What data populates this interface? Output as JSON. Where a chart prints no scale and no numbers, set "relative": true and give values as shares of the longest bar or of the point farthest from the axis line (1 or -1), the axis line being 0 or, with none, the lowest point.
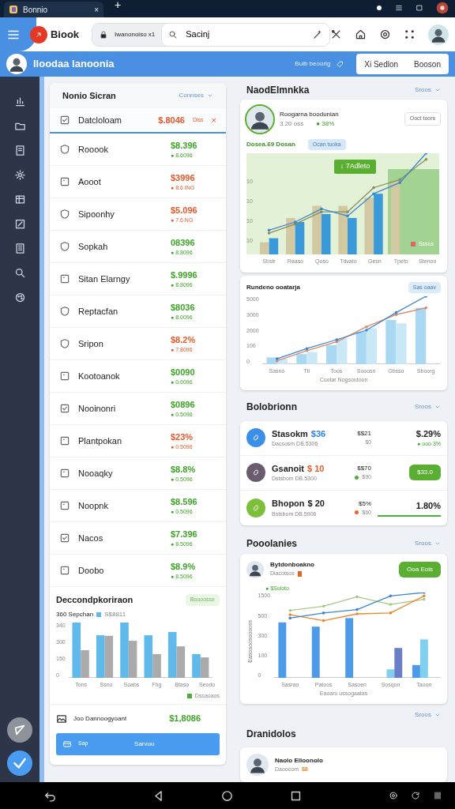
{
  "browser": {
    "tabs": [
      {
        "title": "Bonnio",
        "selected": true,
        "close": "×"
      }
    ],
    "new_tab": "+"
  },
  "address_bar": {
    "logo": "Biook",
    "url": "Iwanonoiso x1",
    "search": {
      "value": "Sacinj"
    }
  },
  "header": {
    "title": "Iloodaa lanoonia",
    "link": "Buib beoorig",
    "buttons": [
      "Xi Sedlon",
      "Booson"
    ]
  },
  "list_panel": {
    "title": "Nonio Sicran",
    "filter": "Connses",
    "rows": [
      {
        "name": "Datcloloam",
        "amount": "$.8046",
        "negative": true,
        "selected": true,
        "tag": "Diss",
        "close": "×"
      },
      {
        "name": "Rooook",
        "amount": "$8.396",
        "negative": false,
        "selected": false,
        "change": "● 8.6096"
      },
      {
        "name": "Aooot",
        "amount": "$3996",
        "negative": true,
        "selected": false,
        "change": "● 8.6 ING"
      },
      {
        "name": "Sipoonhy",
        "amount": "$5.096",
        "negative": true,
        "selected": false,
        "change": "● 7.6 NG"
      },
      {
        "name": "Sopkah",
        "amount": "08396",
        "negative": false,
        "selected": false,
        "change": "● 8.8096"
      },
      {
        "name": "Sitan Elarngy",
        "amount": "$.9996",
        "negative": false,
        "selected": false,
        "change": "● 8.8096"
      },
      {
        "name": "Reptacfan",
        "amount": "$8036",
        "negative": false,
        "selected": false,
        "change": "● 8.0096"
      },
      {
        "name": "Sripon",
        "amount": "$8.2%",
        "negative": true,
        "selected": false,
        "change": "● 7.8096"
      },
      {
        "name": "Kootoanok",
        "amount": "$0090",
        "negative": false,
        "selected": false,
        "change": "● 0.6096"
      },
      {
        "name": "Nooinonri",
        "amount": "$0896",
        "negative": false,
        "selected": false,
        "change": "● 0.5096"
      },
      {
        "name": "Plantpokan",
        "amount": "$23%",
        "negative": true,
        "selected": false,
        "change": "● 0.5096"
      },
      {
        "name": "Nooaqky",
        "amount": "$8.8%",
        "negative": false,
        "selected": false,
        "change": "● 0.5096"
      },
      {
        "name": "Noopnk",
        "amount": "$8.596",
        "negative": false,
        "selected": false,
        "change": "● 0.5096"
      },
      {
        "name": "Nacos",
        "amount": "$7.396",
        "negative": false,
        "selected": false,
        "change": "● 8.5096"
      },
      {
        "name": "Doobo",
        "amount": "$8.9%",
        "negative": false,
        "selected": false,
        "change": "● 8.5096"
      }
    ]
  },
  "summary_chart": {
    "title": "Deccondpkoriraon",
    "badge": "Boooosse",
    "caption": "360 Sepchan",
    "footer_legend": "Dscaoaos",
    "y_labels": [
      "340",
      "300",
      "150",
      "0"
    ],
    "chart_data": {
      "type": "bar",
      "relative": true,
      "categories": [
        "Tons",
        "Ssno",
        "Soabs",
        "Fhg",
        "Btaso",
        "Seodo"
      ],
      "series": [
        {
          "name": "S$8811",
          "color": "#5fb9ea",
          "values": [
            1,
            0.77,
            1,
            0.77,
            0.83,
            0.43
          ]
        },
        {
          "color": "#aaaaaa",
          "values": [
            0.5,
            0.76,
            0.67,
            0.43,
            0.57,
            0.37
          ]
        }
      ]
    }
  },
  "total": {
    "label": "Joo Dannoogyoant",
    "value": "$1,8086"
  },
  "action": {
    "note": "Sap",
    "label": "Sarvuu"
  },
  "metrics": {
    "title": "NaodElmnkka",
    "filter": "Sroos",
    "profile": {
      "name": "Roogarna boodunian",
      "sub": "3.20 oss",
      "stat": "● 38%",
      "button": "Ooct toors"
    },
    "chart": {
      "title": "Dosea.69 Dosan",
      "badge": "Ocan tuoka",
      "tooltip": "↓ 7Adleto",
      "legend": "Sssos",
      "y_labels": [
        "10",
        "10",
        "10",
        "10"
      ],
      "chart_data": {
        "type": "bar",
        "relative": true,
        "categories": [
          "Sbstr",
          "Reaso",
          "Qoso",
          "Tdvato",
          "Gesn",
          "Tpeto",
          "Stenon"
        ],
        "series": [
          {
            "color": "#d2c8a2",
            "values": [
              0.12,
              0.36,
              0.48,
              0.48,
              0.56,
              0.72,
              null
            ]
          },
          {
            "color": "#3a9ad9",
            "values": [
              0.16,
              0.32,
              0.4,
              0.36,
              0.6,
              null,
              null
            ]
          },
          {
            "type": "line",
            "color": "#8a8d5b",
            "values": [
              0.21,
              0.3,
              0.42,
              0.42,
              0.66,
              0.74,
              0.94
            ]
          },
          {
            "type": "line",
            "color": "#3a86d0",
            "values": [
              0.24,
              0.32,
              0.45,
              0.38,
              0.6,
              0.71,
              1
            ]
          }
        ]
      }
    }
  },
  "growth": {
    "title": "Rundeno ooatarja",
    "badge": "Sas oaav",
    "y_labels": [
      "5000",
      "3000",
      "2000",
      "100",
      "0"
    ],
    "chart_data": {
      "type": "bar",
      "relative": true,
      "categories": [
        "Sasno",
        "Tti",
        "Toos",
        "Sooosn",
        "Gbsso",
        "Sboorg"
      ],
      "xlabel": "Cootar Nogsoutoon",
      "series": [
        {
          "color": "#a9d9f2",
          "values": [
            0.1,
            0.15,
            0.28,
            0.48,
            0.65,
            0.83
          ]
        },
        {
          "color": "#cbe8f6",
          "values": [
            0.08,
            0.18,
            0.38,
            0.53,
            0.6,
            null
          ]
        },
        {
          "type": "line",
          "color": "#d9896a",
          "values": [
            0.05,
            0.2,
            0.33,
            0.55,
            0.73,
            0.83
          ]
        },
        {
          "type": "line",
          "color": "#3a86d0",
          "values": [
            0.08,
            0.23,
            0.36,
            0.5,
            0.76,
            1
          ]
        }
      ]
    }
  },
  "balances": {
    "title": "Bolobrionn",
    "filter": "Sroos",
    "rows": [
      {
        "name": "Stasokm",
        "amount": {
          "text": "$36",
          "color": "#2f80ed"
        },
        "color": "#3b8fe8",
        "sub": "Dacsosm DB.5306",
        "mid": "$$21",
        "mid_sub": {
          "text": "$0"
        },
        "kind": "pill",
        "value": "$.29%",
        "extra": "● ooo 3%"
      },
      {
        "name": "Gsanoit",
        "amount": {
          "text": "$ 10",
          "color": "#e35a2b"
        },
        "color": "#6b5b6e",
        "sub": "Dstsbom DB.5300",
        "mid": "$$70",
        "mid_sub": {
          "text": "$90",
          "color": "#4caf3a"
        },
        "kind": "button",
        "value": "$33.0"
      },
      {
        "name": "Bhopon",
        "amount": {
          "text": "$ 20",
          "color": "#222222"
        },
        "color": "#7cbf3a",
        "sub": "Bstsbom DB.5906",
        "mid": "$5%",
        "mid_sub": {
          "text": "$60",
          "color": "#e8622b"
        },
        "kind": "progress",
        "value": "1.80%",
        "level": 1
      }
    ]
  },
  "portfolio": {
    "title": "Pooolanies",
    "filter": "Sroos",
    "name": "Bytdonboakno",
    "sub": "Dlacotsos",
    "button": "Ooa Eois",
    "legend": "● $Soloto",
    "y_labels": [
      "1500",
      "500",
      "300",
      "100",
      "0"
    ],
    "chart_data": {
      "type": "bar",
      "relative": true,
      "categories": [
        "Sasrao",
        "Patoos",
        "Sasoen",
        "Sosqon",
        "Taoon"
      ],
      "xlabel": "Eaoaro ussogaatas",
      "ylabel": "Easoaoosooooss",
      "series": [
        {
          "color": "#4d9ae8",
          "values": [
            0.65,
            0.6,
            0.7,
            null,
            0.15
          ]
        },
        {
          "color": "#7fd0ee",
          "values": [
            null,
            null,
            null,
            0.1,
            0.45
          ]
        },
        {
          "color": "#6b7fc8",
          "values": [
            null,
            null,
            null,
            0.35,
            null
          ]
        },
        {
          "type": "line",
          "color": "#a6c98a",
          "values": [
            0.79,
            0.84,
            0.95,
            0.86,
            0.92
          ]
        },
        {
          "type": "line",
          "color": "#e8892b",
          "values": [
            0.74,
            0.67,
            0.75,
            0.76,
            0.96
          ]
        },
        {
          "type": "line",
          "color": "#3a86d0",
          "values": [
            0.7,
            0.76,
            0.8,
            0.96,
            1
          ]
        }
      ]
    }
  },
  "more_filter": "Sroos",
  "drafts": {
    "title": "Dranidolos",
    "name": "Naolo Elloonolo",
    "sub": "Daoocom",
    "amount": "$8"
  }
}
